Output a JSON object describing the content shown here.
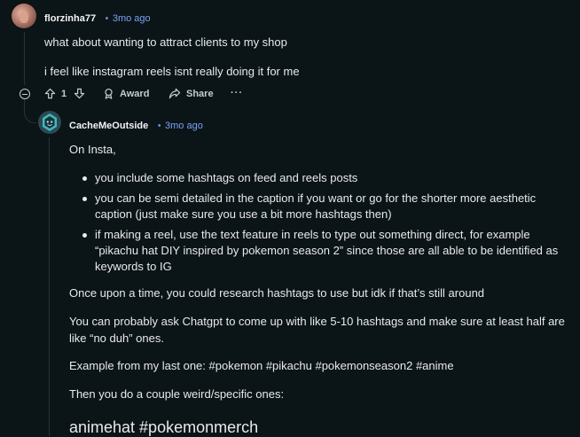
{
  "comment1": {
    "username": "florzinha77",
    "separator": "•",
    "time": "3mo ago",
    "line1": "what about wanting to attract clients to my shop",
    "line2": "i feel like instagram reels isnt really doing it for me",
    "upvotes": "1",
    "award_label": "Award",
    "share_label": "Share",
    "more_label": "···"
  },
  "reply": {
    "username": "CacheMeOutside",
    "separator": "•",
    "time": "3mo ago",
    "intro": "On Insta,",
    "bullets": [
      "you include some hashtags on feed and reels posts",
      "you can be semi detailed in the caption if you want or go for the shorter more aesthetic caption (just make sure you use a bit more hashtags then)",
      "if making a reel, use the text feature in reels to type out something direct, for example “pikachu hat DIY inspired by pokemon season 2” since those are all able to be identified as keywords to IG"
    ],
    "p1": "Once upon a time, you could research hashtags to use but idk if that’s still around",
    "p2a": "You can probably ask Chatgpt to come up with like 5-10 hashtags and make sure at least half are",
    "p2b": "like “no duh” ones.",
    "p3": "Example from my last one: #pokemon #pikachu #pokemonseason2 #anime",
    "p4": "Then you do a couple weird/specific ones:",
    "p5": "animehat #pokemonmerch"
  },
  "colors": {
    "background": "#0b1416",
    "time": "#7aa2f7",
    "text": "#e8eaeb",
    "thread_line": "#2a3236"
  }
}
